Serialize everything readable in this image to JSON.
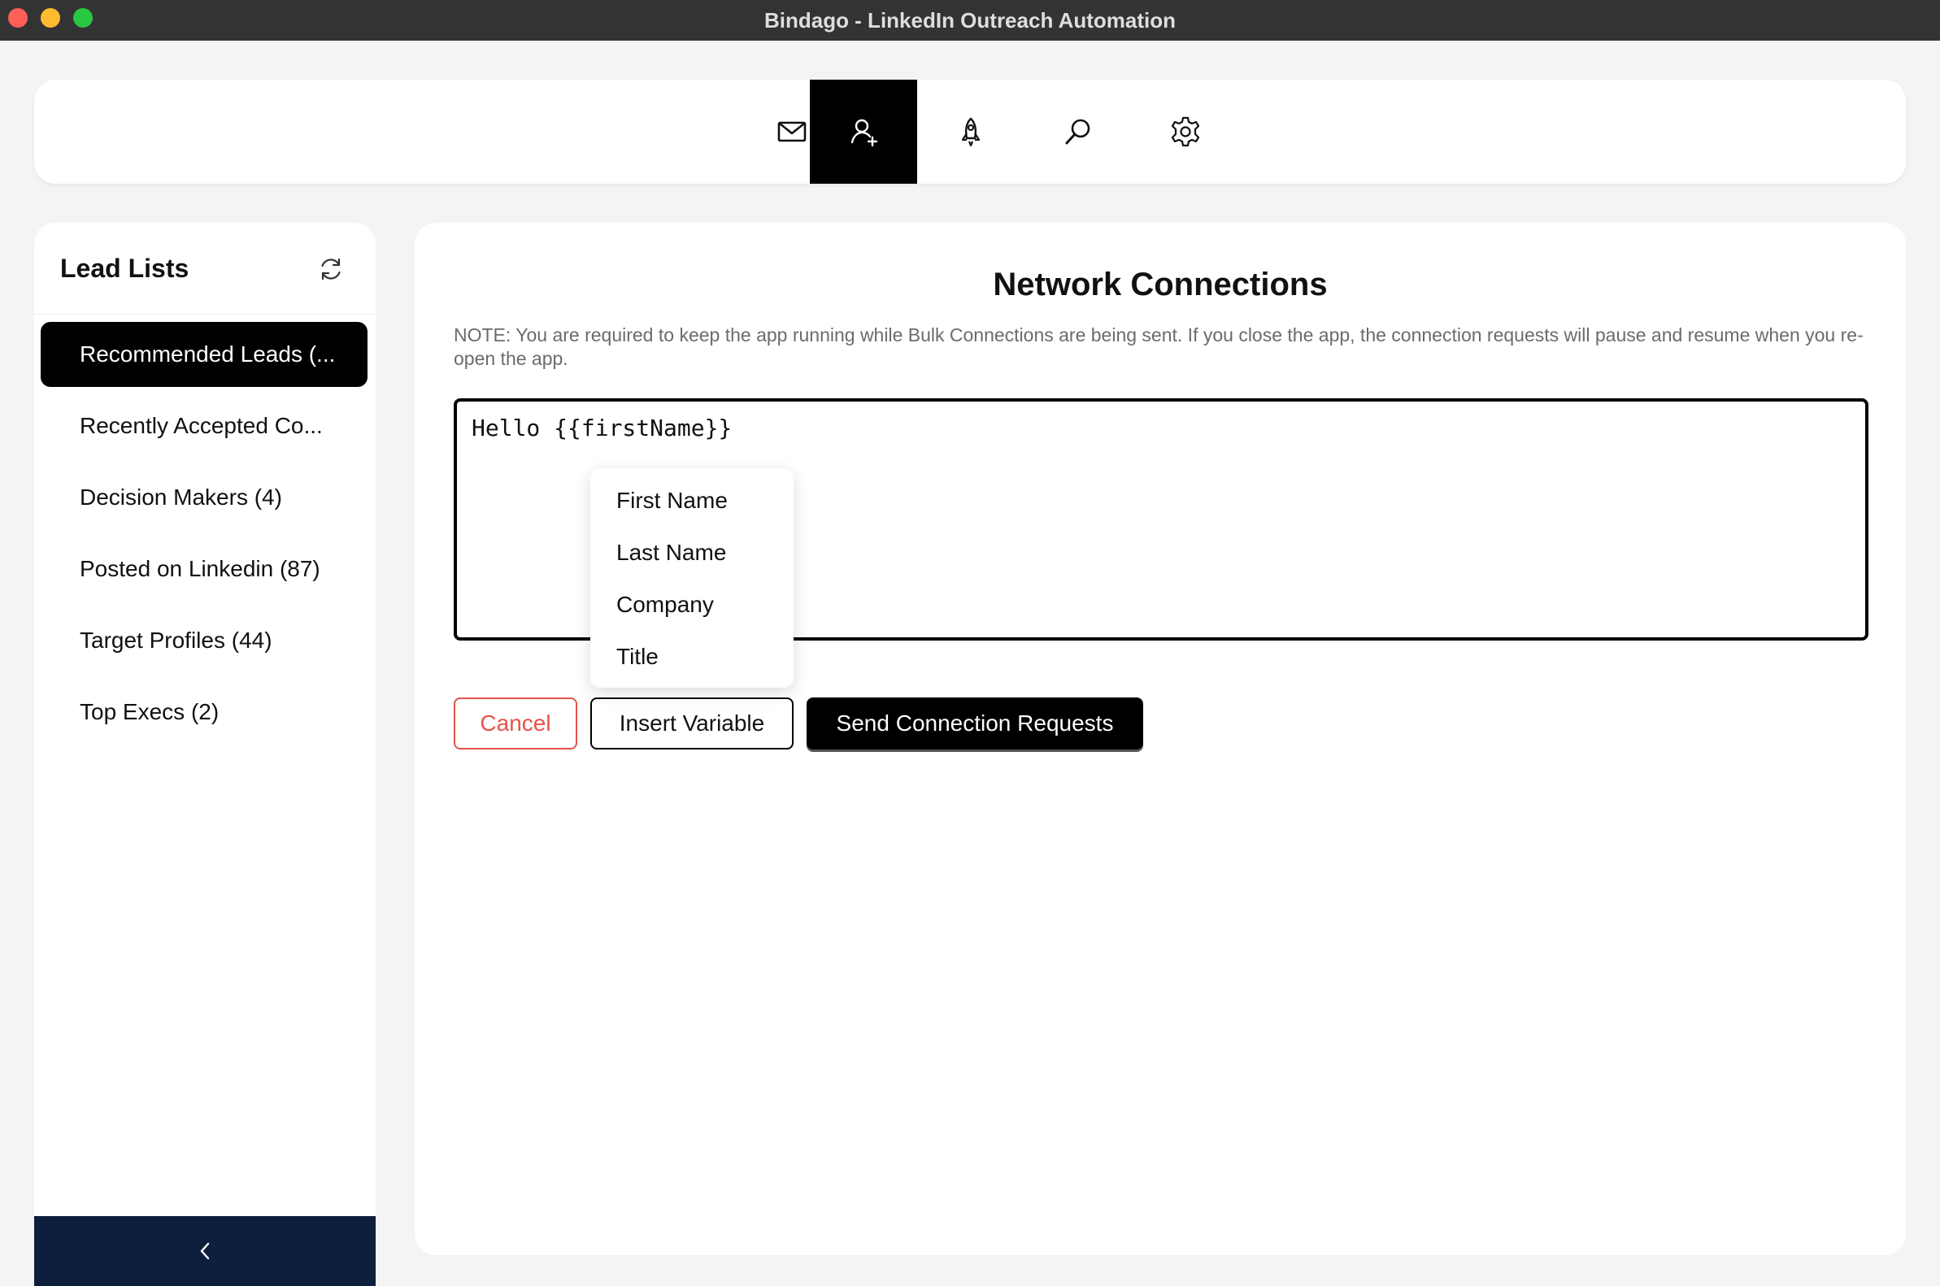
{
  "window": {
    "title": "Bindago - LinkedIn Outreach Automation"
  },
  "nav": {
    "icons": [
      "mail-icon",
      "add-person-icon",
      "rocket-icon",
      "search-icon",
      "settings-icon"
    ],
    "active_index": 1
  },
  "sidebar": {
    "title": "Lead Lists",
    "items": [
      {
        "label": "Recommended Leads (..."
      },
      {
        "label": "Recently Accepted Co..."
      },
      {
        "label": "Decision Makers (4)"
      },
      {
        "label": "Posted on Linkedin (87)"
      },
      {
        "label": "Target Profiles (44)"
      },
      {
        "label": "Top Execs (2)"
      }
    ],
    "active_index": 0,
    "collapse_icon": "chevron-left-icon"
  },
  "main": {
    "title": "Network Connections",
    "note": "NOTE: You are required to keep the app running while Bulk Connections are being sent. If you close the app, the connection requests will pause and resume when you re-open the app.",
    "message": "Hello {{firstName}}",
    "variable_menu": [
      "First Name",
      "Last Name",
      "Company",
      "Title"
    ],
    "buttons": {
      "cancel": "Cancel",
      "insert_variable": "Insert Variable",
      "send": "Send Connection Requests"
    }
  },
  "colors": {
    "accent": "#000000",
    "danger": "#e5534b",
    "sidebar_footer": "#0d1f3c",
    "titlebar": "#333333"
  }
}
